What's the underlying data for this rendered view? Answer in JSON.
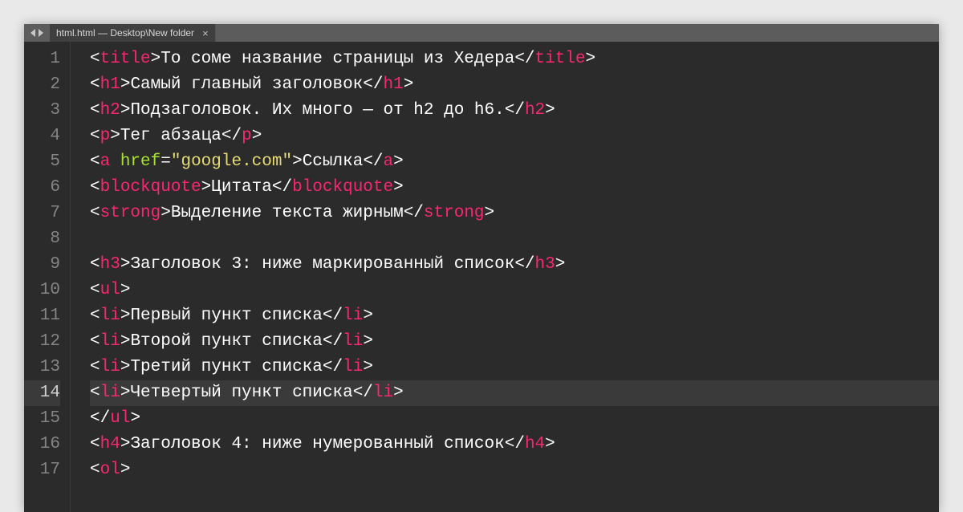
{
  "tab": {
    "title": "html.html — Desktop\\New folder",
    "close": "×"
  },
  "activeLine": 14,
  "lines": [
    {
      "n": 1,
      "tokens": [
        [
          "pun",
          "<"
        ],
        [
          "tag",
          "title"
        ],
        [
          "pun",
          ">"
        ],
        [
          "txt",
          "То соме название страницы из Хедера"
        ],
        [
          "pun",
          "</"
        ],
        [
          "tag",
          "title"
        ],
        [
          "pun",
          ">"
        ]
      ]
    },
    {
      "n": 2,
      "tokens": [
        [
          "pun",
          "<"
        ],
        [
          "tag",
          "h1"
        ],
        [
          "pun",
          ">"
        ],
        [
          "txt",
          "Самый главный заголовок"
        ],
        [
          "pun",
          "</"
        ],
        [
          "tag",
          "h1"
        ],
        [
          "pun",
          ">"
        ]
      ]
    },
    {
      "n": 3,
      "tokens": [
        [
          "pun",
          "<"
        ],
        [
          "tag",
          "h2"
        ],
        [
          "pun",
          ">"
        ],
        [
          "txt",
          "Подзаголовок. Их много — от h2 до h6."
        ],
        [
          "pun",
          "</"
        ],
        [
          "tag",
          "h2"
        ],
        [
          "pun",
          ">"
        ]
      ]
    },
    {
      "n": 4,
      "tokens": [
        [
          "pun",
          "<"
        ],
        [
          "tag",
          "p"
        ],
        [
          "pun",
          ">"
        ],
        [
          "txt",
          "Тег абзаца"
        ],
        [
          "pun",
          "</"
        ],
        [
          "tag",
          "p"
        ],
        [
          "pun",
          ">"
        ]
      ]
    },
    {
      "n": 5,
      "tokens": [
        [
          "pun",
          "<"
        ],
        [
          "tag",
          "a"
        ],
        [
          "txt",
          " "
        ],
        [
          "attr",
          "href"
        ],
        [
          "pun",
          "="
        ],
        [
          "str",
          "\"google.com\""
        ],
        [
          "pun",
          ">"
        ],
        [
          "txt",
          "Ссылка"
        ],
        [
          "pun",
          "</"
        ],
        [
          "tag",
          "a"
        ],
        [
          "pun",
          ">"
        ]
      ]
    },
    {
      "n": 6,
      "tokens": [
        [
          "pun",
          "<"
        ],
        [
          "tag",
          "blockquote"
        ],
        [
          "pun",
          ">"
        ],
        [
          "txt",
          "Цитата"
        ],
        [
          "pun",
          "</"
        ],
        [
          "tag",
          "blockquote"
        ],
        [
          "pun",
          ">"
        ]
      ]
    },
    {
      "n": 7,
      "tokens": [
        [
          "pun",
          "<"
        ],
        [
          "tag",
          "strong"
        ],
        [
          "pun",
          ">"
        ],
        [
          "txt",
          "Выделение текста жирным"
        ],
        [
          "pun",
          "</"
        ],
        [
          "tag",
          "strong"
        ],
        [
          "pun",
          ">"
        ]
      ]
    },
    {
      "n": 8,
      "tokens": []
    },
    {
      "n": 9,
      "tokens": [
        [
          "pun",
          "<"
        ],
        [
          "tag",
          "h3"
        ],
        [
          "pun",
          ">"
        ],
        [
          "txt",
          "Заголовок 3: ниже маркированный список"
        ],
        [
          "pun",
          "</"
        ],
        [
          "tag",
          "h3"
        ],
        [
          "pun",
          ">"
        ]
      ]
    },
    {
      "n": 10,
      "tokens": [
        [
          "pun",
          "<"
        ],
        [
          "tag",
          "ul"
        ],
        [
          "pun",
          ">"
        ]
      ]
    },
    {
      "n": 11,
      "tokens": [
        [
          "pun",
          "<"
        ],
        [
          "tag",
          "li"
        ],
        [
          "pun",
          ">"
        ],
        [
          "txt",
          "Первый пункт списка"
        ],
        [
          "pun",
          "</"
        ],
        [
          "tag",
          "li"
        ],
        [
          "pun",
          ">"
        ]
      ]
    },
    {
      "n": 12,
      "tokens": [
        [
          "pun",
          "<"
        ],
        [
          "tag",
          "li"
        ],
        [
          "pun",
          ">"
        ],
        [
          "txt",
          "Второй пункт списка"
        ],
        [
          "pun",
          "</"
        ],
        [
          "tag",
          "li"
        ],
        [
          "pun",
          ">"
        ]
      ]
    },
    {
      "n": 13,
      "tokens": [
        [
          "pun",
          "<"
        ],
        [
          "tag",
          "li"
        ],
        [
          "pun",
          ">"
        ],
        [
          "txt",
          "Третий пункт списка"
        ],
        [
          "pun",
          "</"
        ],
        [
          "tag",
          "li"
        ],
        [
          "pun",
          ">"
        ]
      ]
    },
    {
      "n": 14,
      "tokens": [
        [
          "pun",
          "<"
        ],
        [
          "tag",
          "li"
        ],
        [
          "pun",
          ">"
        ],
        [
          "txt",
          "Четвертый пункт списка"
        ],
        [
          "pun",
          "</"
        ],
        [
          "tag",
          "li"
        ],
        [
          "pun",
          ">"
        ]
      ]
    },
    {
      "n": 15,
      "tokens": [
        [
          "pun",
          "</"
        ],
        [
          "tag",
          "ul"
        ],
        [
          "pun",
          ">"
        ]
      ]
    },
    {
      "n": 16,
      "tokens": [
        [
          "pun",
          "<"
        ],
        [
          "tag",
          "h4"
        ],
        [
          "pun",
          ">"
        ],
        [
          "txt",
          "Заголовок 4: ниже нумерованный список"
        ],
        [
          "pun",
          "</"
        ],
        [
          "tag",
          "h4"
        ],
        [
          "pun",
          ">"
        ]
      ]
    },
    {
      "n": 17,
      "tokens": [
        [
          "pun",
          "<"
        ],
        [
          "tag",
          "ol"
        ],
        [
          "pun",
          ">"
        ]
      ]
    }
  ]
}
